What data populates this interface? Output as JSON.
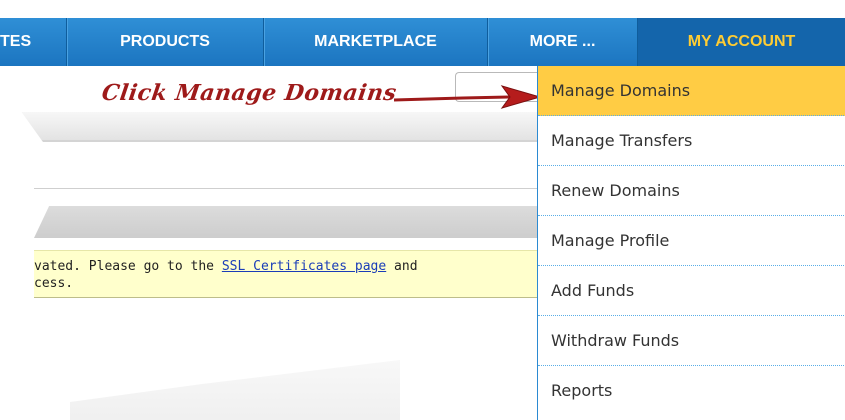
{
  "nav": {
    "items": [
      "TES",
      "PRODUCTS",
      "MARKETPLACE",
      "MORE ...",
      "MY ACCOUNT"
    ],
    "colors": {
      "bar": "#1c75c0",
      "active_text": "#ffcc33"
    }
  },
  "annotation": {
    "text": "Click Manage Domains",
    "color": "#9e1a1a"
  },
  "notice": {
    "line1_before": "vated. Please go to the ",
    "link": "SSL Certificates page",
    "line1_after": " and",
    "line2": "cess."
  },
  "dropdown": {
    "items": [
      "Manage Domains",
      "Manage Transfers",
      "Renew Domains",
      "Manage Profile",
      "Add Funds",
      "Withdraw Funds",
      "Reports"
    ],
    "highlight_color": "#ffcc44"
  }
}
